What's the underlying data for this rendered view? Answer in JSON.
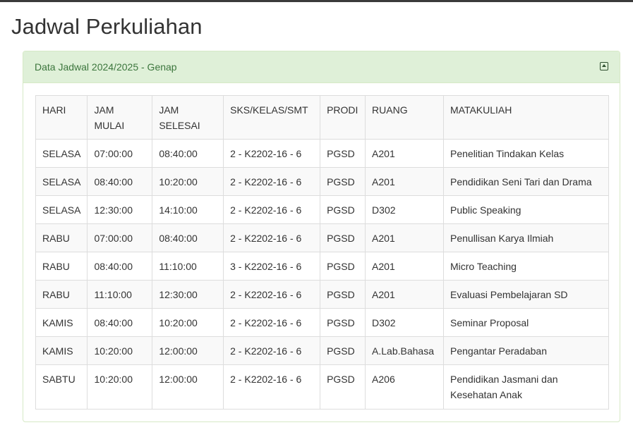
{
  "page": {
    "title": "Jadwal Perkuliahan"
  },
  "panel": {
    "title": "Data Jadwal 2024/2025 - Genap",
    "collapse_icon": "collapse-up-icon"
  },
  "table": {
    "headers": [
      [
        "HARI"
      ],
      [
        "JAM",
        "MULAI"
      ],
      [
        "JAM",
        "SELESAI"
      ],
      [
        "SKS/KELAS/SMT"
      ],
      [
        "PRODI"
      ],
      [
        "RUANG"
      ],
      [
        "MATAKULIAH"
      ]
    ],
    "rows": [
      [
        "SELASA",
        "07:00:00",
        "08:40:00",
        "2 - K2202-16 - 6",
        "PGSD",
        "A201",
        "Penelitian Tindakan Kelas"
      ],
      [
        "SELASA",
        "08:40:00",
        "10:20:00",
        "2 - K2202-16 - 6",
        "PGSD",
        "A201",
        "Pendidikan Seni Tari dan Drama"
      ],
      [
        "SELASA",
        "12:30:00",
        "14:10:00",
        "2 - K2202-16 - 6",
        "PGSD",
        "D302",
        "Public Speaking"
      ],
      [
        "RABU",
        "07:00:00",
        "08:40:00",
        "2 - K2202-16 - 6",
        "PGSD",
        "A201",
        "Penullisan Karya Ilmiah"
      ],
      [
        "RABU",
        "08:40:00",
        "11:10:00",
        "3 - K2202-16 - 6",
        "PGSD",
        "A201",
        "Micro Teaching"
      ],
      [
        "RABU",
        "11:10:00",
        "12:30:00",
        "2 - K2202-16 - 6",
        "PGSD",
        "A201",
        "Evaluasi Pembelajaran SD"
      ],
      [
        "KAMIS",
        "08:40:00",
        "10:20:00",
        "2 - K2202-16 - 6",
        "PGSD",
        "D302",
        "Seminar Proposal"
      ],
      [
        "KAMIS",
        "10:20:00",
        "12:00:00",
        "2 - K2202-16 - 6",
        "PGSD",
        "A.Lab.Bahasa",
        "Pengantar Peradaban"
      ],
      [
        "SABTU",
        "10:20:00",
        "12:00:00",
        "2 - K2202-16 - 6",
        "PGSD",
        "A206",
        "Pendidikan Jasmani dan Kesehatan Anak"
      ]
    ]
  }
}
